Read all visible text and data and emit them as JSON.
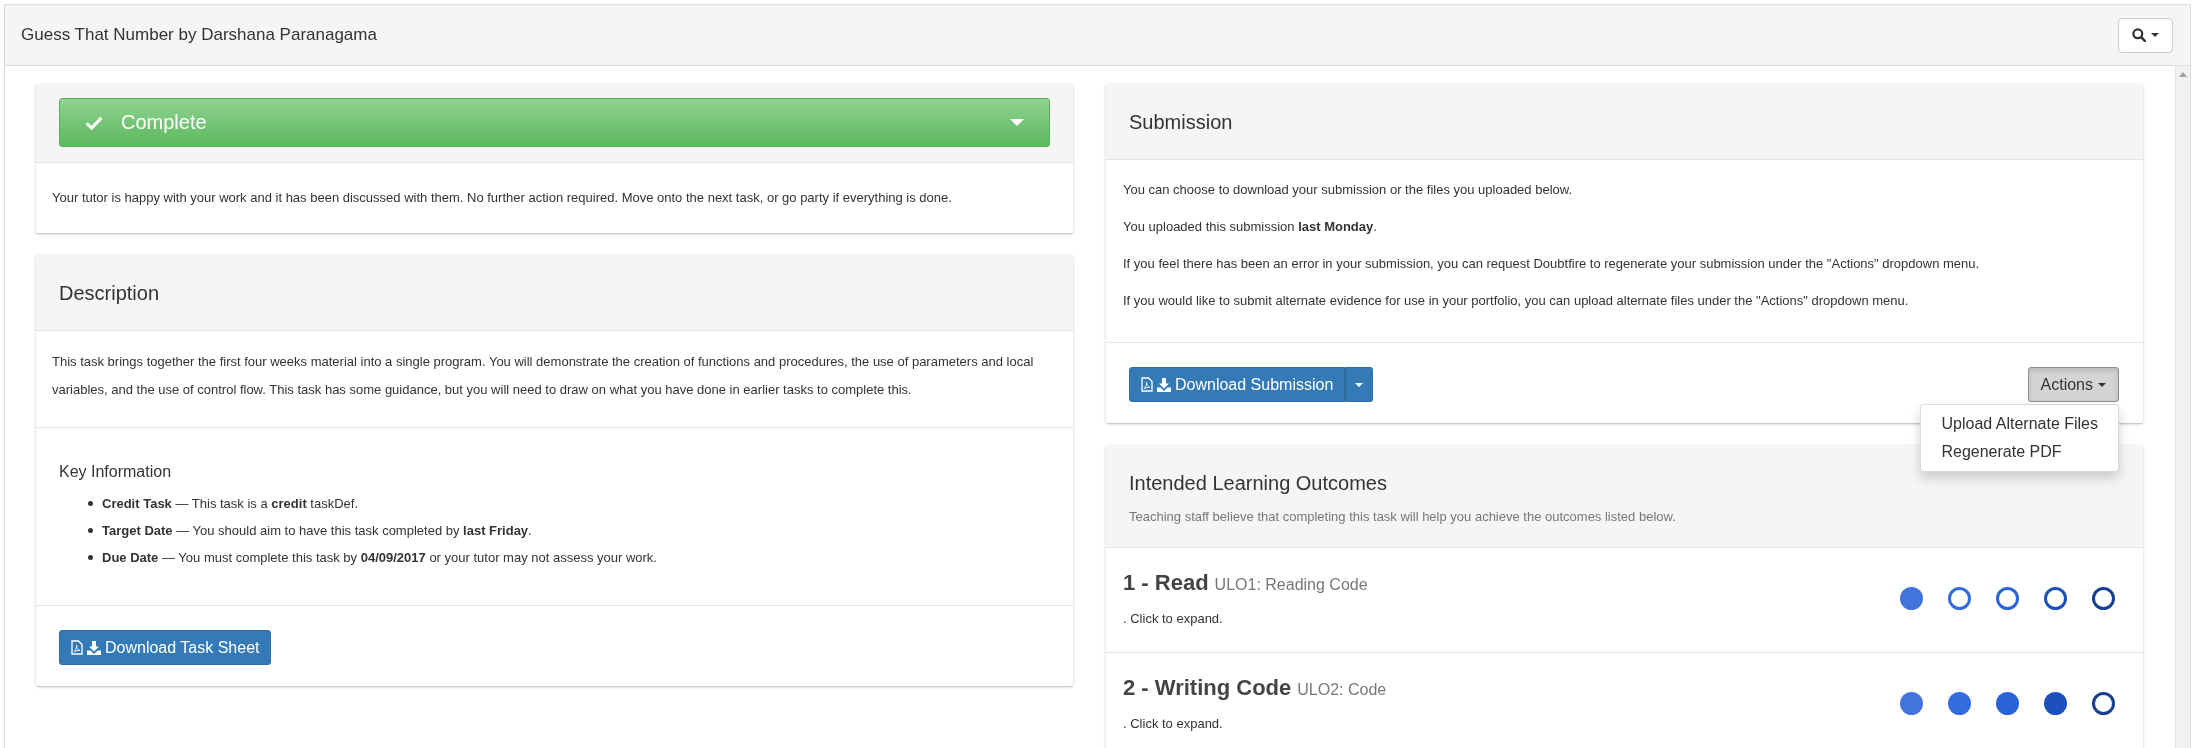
{
  "window": {
    "title": "Guess That Number by Darshana Paranagama"
  },
  "status": {
    "label": "Complete",
    "message": "Your tutor is happy with your work and it has been discussed with them. No further action required. Move onto the next task, or go party if everything is done."
  },
  "description": {
    "title": "Description",
    "text": "This task brings together the first four weeks material into a single program. You will demonstrate the creation of functions and procedures, the use of parameters and local variables, and the use of control flow. This task has some guidance, but you will need to draw on what you have done in earlier tasks to complete this.",
    "key_information": {
      "title": "Key Information",
      "items": [
        "**Credit Task** — This task is a **credit** taskDef.",
        "**Target Date** — You should aim to have this task completed by **last Friday**.",
        "**Due Date** — You must complete this task by **04/09/2017** or your tutor may not assess your work."
      ]
    },
    "download_button": "Download Task Sheet"
  },
  "submission": {
    "title": "Submission",
    "paragraphs": [
      "You can choose to download your submission or the files you uploaded below.",
      "You uploaded this submission **last Monday**.",
      "If you feel there has been an error in your submission, you can request Doubtfire to regenerate your submission under the \"Actions\" dropdown menu.",
      "If you would like to submit alternate evidence for use in your portfolio, you can upload alternate files under the \"Actions\" dropdown menu."
    ],
    "download_button": "Download Submission",
    "actions": {
      "label": "Actions",
      "expanded": true,
      "items": [
        "Upload Alternate Files",
        "Regenerate PDF"
      ]
    }
  },
  "learning_outcomes": {
    "title": "Intended Learning Outcomes",
    "subtitle": "Teaching staff believe that completing this task will help you achieve the outcomes listed below.",
    "outcomes": [
      {
        "title": "1 - Read",
        "code": "ULO1: Reading Code",
        "hint": ". Click to expand.",
        "stars": 1
      },
      {
        "title": "2 - Writing Code",
        "code": "ULO2: Code",
        "hint": ". Click to expand.",
        "stars": 4
      }
    ]
  }
}
